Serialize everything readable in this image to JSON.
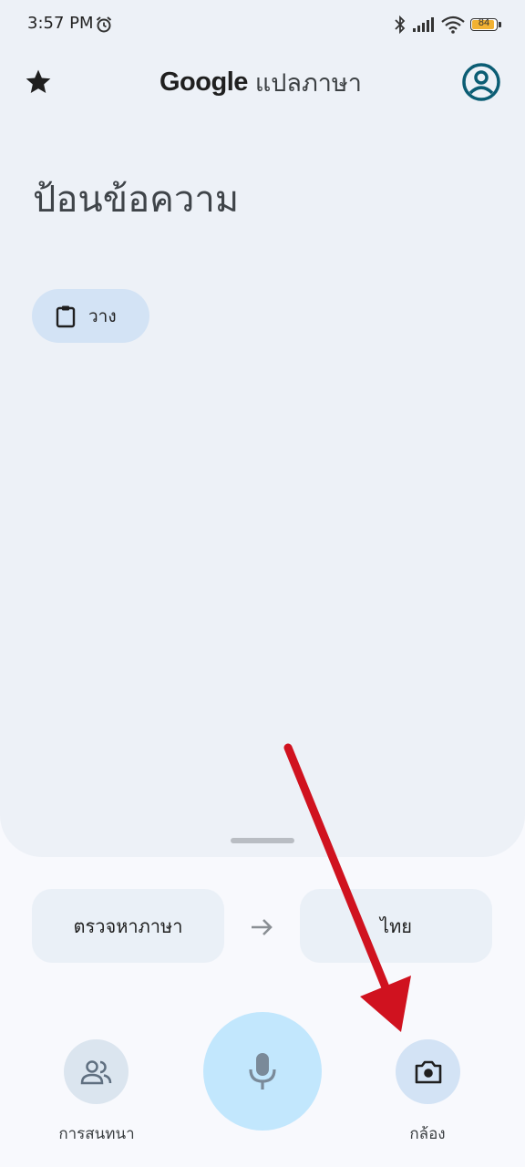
{
  "status_bar": {
    "time": "3:57 PM",
    "battery": "84",
    "icons": [
      "alarm-icon",
      "bluetooth-icon",
      "signal-icon",
      "wifi-icon",
      "battery-icon"
    ]
  },
  "header": {
    "brand": "Google",
    "title_suffix": "แปลภาษา",
    "left_icon": "star-icon",
    "right_icon": "account-icon"
  },
  "input": {
    "placeholder": "ป้อนข้อความ",
    "paste_label": "วาง",
    "paste_icon": "clipboard-icon"
  },
  "languages": {
    "source": "ตรวจหาภาษา",
    "target": "ไทย",
    "swap_icon": "arrow-right-icon"
  },
  "actions": {
    "conversation_label": "การสนทนา",
    "camera_label": "กล้อง",
    "mic_icon": "mic-icon",
    "conversation_icon": "people-icon",
    "camera_icon": "camera-icon"
  },
  "colors": {
    "top_panel": "#edf1f7",
    "paste_chip": "#d3e3f5",
    "mic_button": "#c2e7fd",
    "mic_icon": "#7a8a99",
    "account_icon": "#0b5d74",
    "annotation_arrow": "#d0121f"
  }
}
